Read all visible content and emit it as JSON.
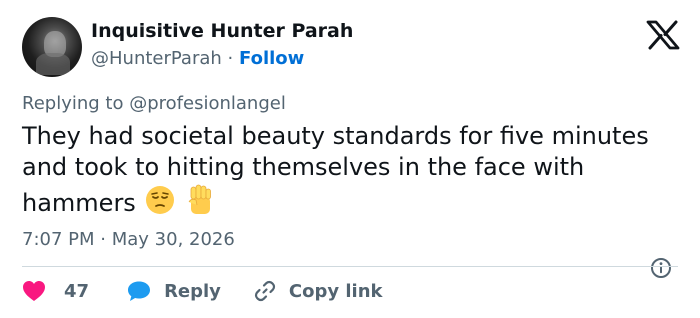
{
  "author": {
    "display_name": "Inquisitive Hunter Parah",
    "handle": "@HunterParah",
    "separator": "·",
    "follow_label": "Follow"
  },
  "reply_context": {
    "prefix": "Replying to",
    "mention": "@profesionlangel"
  },
  "tweet": {
    "text": "They had societal beauty standards for five minutes and took to hitting themselves in the face with hammers",
    "emojis": [
      "pensive-face",
      "raised-fist"
    ],
    "time": "7:07 PM",
    "separator": "·",
    "date": "May 30, 2026"
  },
  "actions": {
    "like_count": "47",
    "reply_label": "Reply",
    "copy_link_label": "Copy link"
  },
  "icons": {
    "brand": "x-logo",
    "info": "info-icon",
    "like": "heart-icon",
    "reply": "chat-bubble-icon",
    "copy": "link-icon"
  },
  "colors": {
    "text": "#0f1419",
    "secondary": "#536471",
    "link": "#006fd6",
    "heart": "#f91880",
    "reply_bubble": "#1d9bf0",
    "divider": "#cfd9de"
  }
}
